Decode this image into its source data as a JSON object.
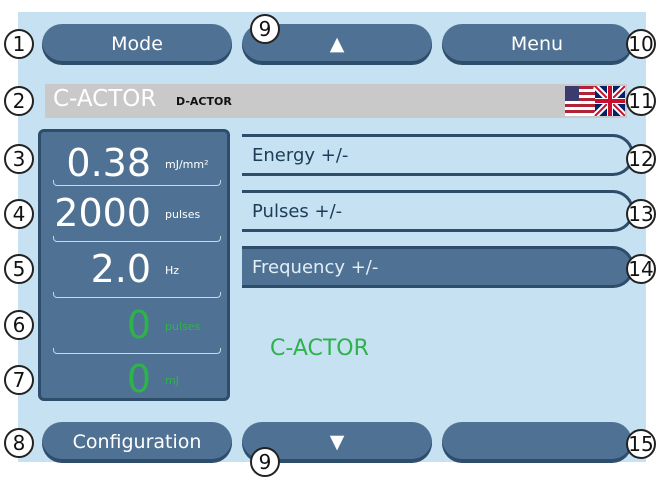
{
  "buttons": {
    "mode": "Mode",
    "up": "▲",
    "menu": "Menu",
    "configuration": "Configuration",
    "down": "▼",
    "blank": ""
  },
  "title": {
    "main": "C-ACTOR",
    "sub": "D-ACTOR"
  },
  "params": [
    {
      "value": "0.38",
      "unit": "mJ/mm²"
    },
    {
      "value": "2000",
      "unit": "pulses"
    },
    {
      "value": "2.0",
      "unit": "Hz"
    },
    {
      "value": "0",
      "unit": "pulses"
    },
    {
      "value": "0",
      "unit": "mJ"
    }
  ],
  "controls": {
    "energy": "Energy +/-",
    "pulses": "Pulses +/-",
    "frequency": "Frequency +/-"
  },
  "status_text": "C-ACTOR",
  "markers": [
    "1",
    "2",
    "3",
    "4",
    "5",
    "6",
    "7",
    "8",
    "9",
    "10",
    "11",
    "12",
    "13",
    "14",
    "15",
    "9"
  ],
  "colors": {
    "panel": "#c5e1f2",
    "button": "#4f7294",
    "accent_green": "#2db34a"
  }
}
